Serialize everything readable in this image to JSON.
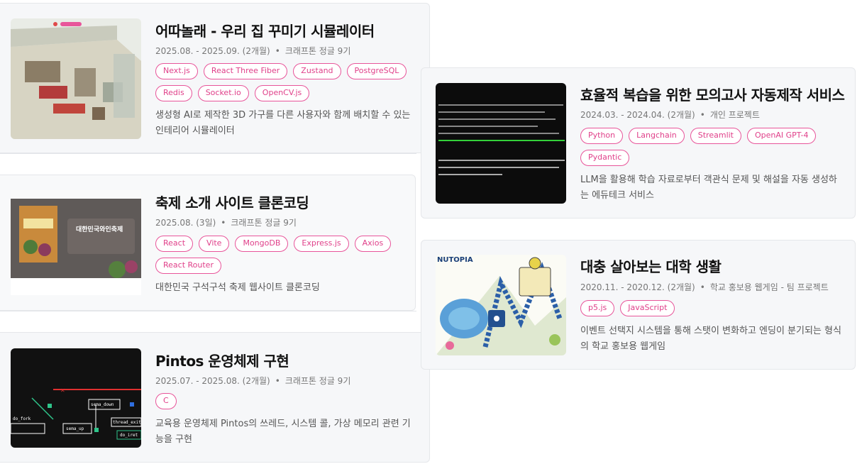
{
  "projects_left": [
    {
      "title": "어따놀래 - 우리 집 꾸미기 시뮬레이터",
      "period": "2025.08. - 2025.09. (2개월)",
      "org": "크래프톤 정글 9기",
      "tags": [
        "Next.js",
        "React Three Fiber",
        "Zustand",
        "PostgreSQL",
        "Redis",
        "Socket.io",
        "OpenCV.js"
      ],
      "desc": "생성형 AI로 제작한 3D 가구를 다른 사용자와 함께 배치할 수 있는 인테리어 시뮬레이터"
    },
    {
      "title": "축제 소개 사이트 클론코딩",
      "period": "2025.08. (3일)",
      "org": "크래프톤 정글 9기",
      "tags": [
        "React",
        "Vite",
        "MongoDB",
        "Express.js",
        "Axios",
        "React Router"
      ],
      "desc": "대한민국 구석구석 축제 웹사이트 클론코딩",
      "thumb_text": "대한민국와인축제"
    },
    {
      "title": "Pintos 운영체제 구현",
      "period": "2025.07. - 2025.08. (2개월)",
      "org": "크래프톤 정글 9기",
      "tags": [
        "C"
      ],
      "desc": "교육용 운영체제 Pintos의 쓰레드, 시스템 콜, 가상 메모리 관련 기능을 구현",
      "thumb_labels": [
        "sema_down",
        "sema_up",
        "thread_exit",
        "do_iret",
        "do_fork"
      ]
    }
  ],
  "projects_right": [
    {
      "title": "효율적 복습을 위한 모의고사 자동제작 서비스",
      "period": "2024.03. - 2024.04. (2개월)",
      "org": "개인 프로젝트",
      "tags": [
        "Python",
        "Langchain",
        "Streamlit",
        "OpenAI GPT-4",
        "Pydantic"
      ],
      "desc": "LLM을 활용해 학습 자료로부터 객관식 문제 및 해설을 자동 생성하는 에듀테크 서비스"
    },
    {
      "title": "대충 살아보는 대학 생활",
      "period": "2020.11. - 2020.12. (2개월)",
      "org": "학교 홍보용 웹게임 - 팀 프로젝트",
      "tags": [
        "p5.js",
        "JavaScript"
      ],
      "desc": "이벤트 선택지 시스템을 통해 스탯이 변화하고 엔딩이 분기되는 형식의 학교 홍보용 웹게임",
      "thumb_text": "NUTOPIA"
    }
  ],
  "colors": {
    "tag_border": "#e8559a",
    "tag_text": "#e0408a",
    "card_bg": "#f6f7f9"
  }
}
